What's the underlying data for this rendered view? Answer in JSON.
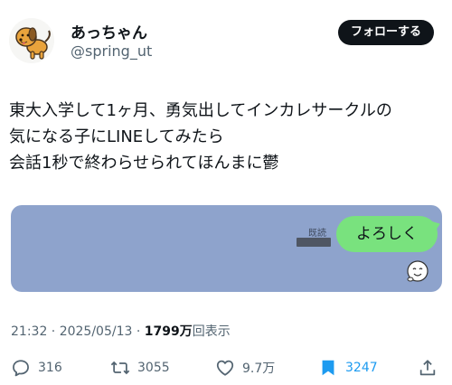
{
  "author": {
    "name": "あっちゃん",
    "handle": "@spring_ut",
    "avatar": "dog-icon"
  },
  "follow_label": "フォローする",
  "tweet_lines": [
    "東大入学して1ヶ月、勇気出してインカレサークルの",
    "気になる子にLINEしてみたら",
    "会話1秒で終わらせられてほんまに鬱"
  ],
  "media": {
    "read_label": "既読",
    "message": "よろしく",
    "sticker": "sticker-face-icon",
    "background_color": "#8ea3cc",
    "bubble_color": "#79e27e"
  },
  "meta": {
    "time_date": "21:32 · 2025/05/13 · ",
    "views_count": "1799万",
    "views_label": "回表示"
  },
  "actions": {
    "replies": "316",
    "reposts": "3055",
    "likes": "9.7万",
    "bookmarks": "3247"
  },
  "colors": {
    "accent": "#1d9bf0",
    "text": "#0f1419",
    "secondary": "#536471"
  }
}
